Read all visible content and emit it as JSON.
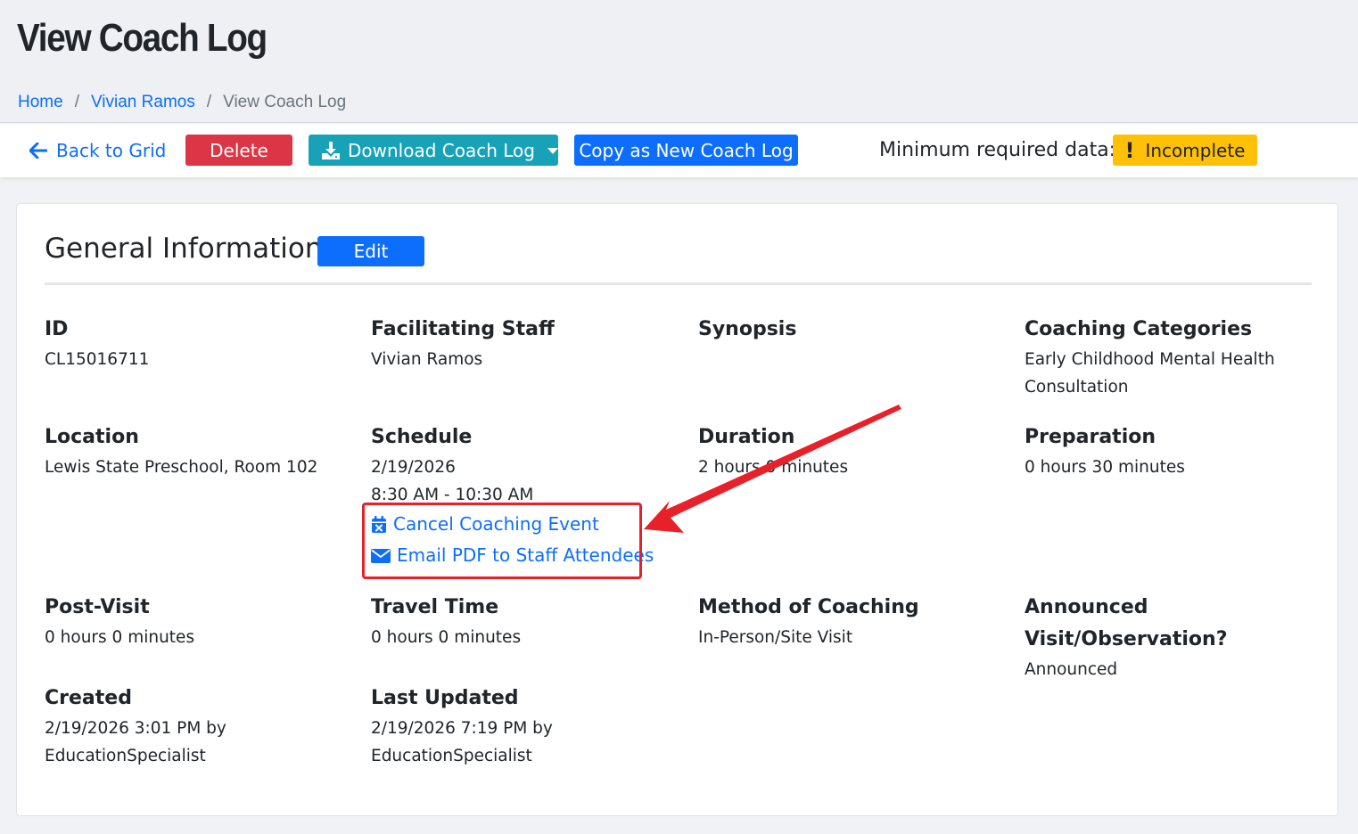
{
  "page": {
    "title": "View Coach Log"
  },
  "breadcrumb": {
    "items": [
      "Home",
      "Vivian Ramos"
    ],
    "separator": "/",
    "current": "View Coach Log"
  },
  "toolbar": {
    "back_label": "Back to Grid",
    "delete_label": "Delete",
    "download_label": "Download Coach Log",
    "copy_label": "Copy as New Coach Log",
    "min_required_label": "Minimum required data:",
    "status_label": "Incomplete",
    "status_icon_glyph": "!"
  },
  "general": {
    "title": "General Information",
    "edit_label": "Edit",
    "fields": {
      "id": {
        "label": "ID",
        "value": "CL15016711"
      },
      "facilitating_staff": {
        "label": "Facilitating Staff",
        "value": "Vivian Ramos"
      },
      "synopsis": {
        "label": "Synopsis",
        "value": ""
      },
      "coaching_categories": {
        "label": "Coaching Categories",
        "value": "Early Childhood Mental Health Consultation"
      },
      "location": {
        "label": "Location",
        "value": "Lewis State Preschool, Room 102"
      },
      "schedule": {
        "label": "Schedule",
        "date": "2/19/2026",
        "time": "8:30 AM - 10:30 AM",
        "cancel_label": "Cancel Coaching Event",
        "email_label": "Email PDF to Staff Attendees"
      },
      "duration": {
        "label": "Duration",
        "value": "2 hours 0 minutes"
      },
      "preparation": {
        "label": "Preparation",
        "value": "0 hours 30 minutes"
      },
      "post_visit": {
        "label": "Post-Visit",
        "value": "0 hours 0 minutes"
      },
      "travel_time": {
        "label": "Travel Time",
        "value": "0 hours 0 minutes"
      },
      "method": {
        "label": "Method of Coaching",
        "value": "In-Person/Site Visit"
      },
      "announced": {
        "label": "Announced Visit/Observation?",
        "value": "Announced"
      },
      "created": {
        "label": "Created",
        "value": "2/19/2026 3:01 PM by EducationSpecialist"
      },
      "last_updated": {
        "label": "Last Updated",
        "value": "2/19/2026 7:19 PM by EducationSpecialist"
      }
    }
  },
  "icons": {
    "back": "arrow-left-icon",
    "download": "download-icon",
    "caret": "caret-down-icon",
    "status": "exclamation-icon",
    "cancel": "calendar-x-icon",
    "email": "envelope-icon"
  },
  "colors": {
    "primary": "#0d6efd",
    "danger": "#dc3545",
    "info": "#17a2b8",
    "warning": "#ffc107",
    "annotation": "#e8202a"
  }
}
